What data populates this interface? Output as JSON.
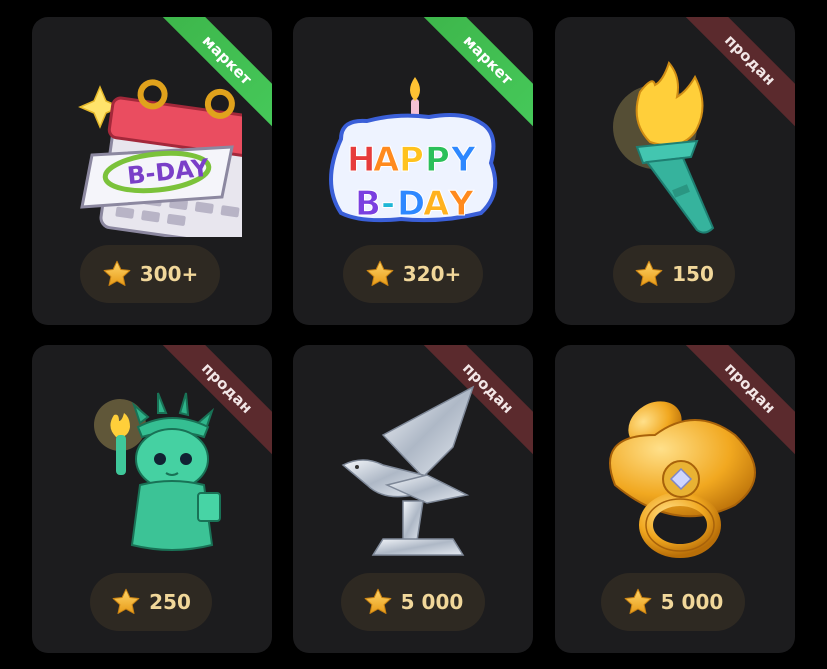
{
  "gifts": [
    {
      "badge": "маркет",
      "badge_type": "market",
      "price": "300+",
      "item_icon": "birthday-calendar-icon"
    },
    {
      "badge": "маркет",
      "badge_type": "market",
      "price": "320+",
      "item_icon": "happy-bday-cake-icon"
    },
    {
      "badge": "продан",
      "badge_type": "sold",
      "price": "150",
      "item_icon": "torch-icon"
    },
    {
      "badge": "продан",
      "badge_type": "sold",
      "price": "250",
      "item_icon": "statue-of-liberty-icon"
    },
    {
      "badge": "продан",
      "badge_type": "sold",
      "price": "5 000",
      "item_icon": "crystal-eagle-icon"
    },
    {
      "badge": "продан",
      "badge_type": "sold",
      "price": "5 000",
      "item_icon": "gold-pacifier-icon"
    }
  ],
  "colors": {
    "background": "#000000",
    "card": "#1c1c1e",
    "market_badge": "#46c95a",
    "sold_badge": "#5b2a2d",
    "price_pill": "#2e2922",
    "price_text": "#f1d79a",
    "star": "#f5b82e"
  }
}
